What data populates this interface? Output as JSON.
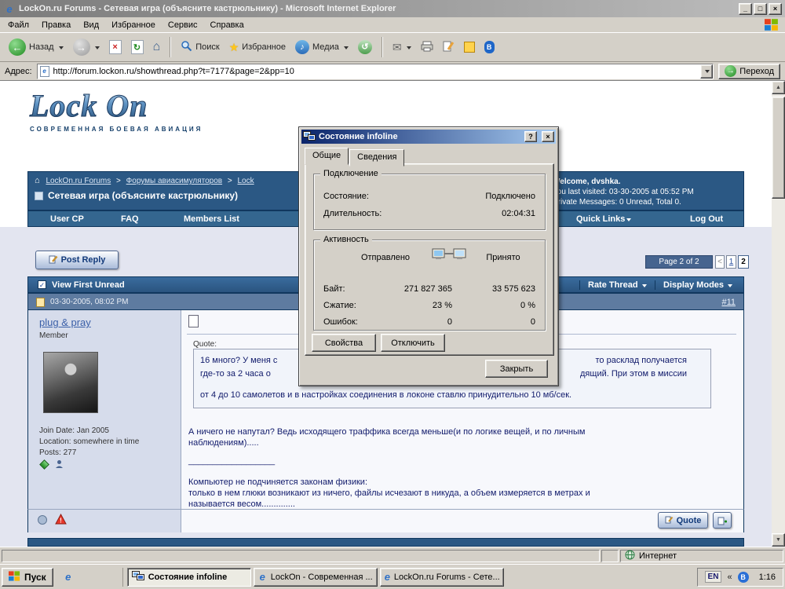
{
  "icons": {
    "minimize": "_",
    "maximize": "□",
    "close": "×",
    "help": "?",
    "back_arrow": "←",
    "forward_arrow": "→",
    "stop": "×",
    "refresh": "↻",
    "home": "⌂",
    "star": "★",
    "media_note": "♪",
    "history": "↺",
    "mail": "✉",
    "go_arrow": "→",
    "check": "✓",
    "scroll_up": "▲",
    "scroll_down": "▼",
    "chevron_left": "«",
    "bluetooth": "B",
    "ie": "e"
  },
  "browser": {
    "title": "LockOn.ru Forums - Сетевая игра (объясните кастрюльнику) - Microsoft Internet Explorer",
    "menu": [
      "Файл",
      "Правка",
      "Вид",
      "Избранное",
      "Сервис",
      "Справка"
    ],
    "toolbar": {
      "back": "Назад",
      "search": "Поиск",
      "favorites": "Избранное",
      "media": "Медиа"
    },
    "address": {
      "label": "Адрес:",
      "value": "http://forum.lockon.ru/showthread.php?t=7177&page=2&pp=10",
      "go": "Переход"
    }
  },
  "dialog": {
    "title": "Состояние infoline",
    "tabs": [
      "Общие",
      "Сведения"
    ],
    "connection": {
      "title": "Подключение",
      "rows": [
        {
          "label": "Состояние:",
          "value": "Подключено"
        },
        {
          "label": "Длительность:",
          "value": "02:04:31"
        }
      ]
    },
    "activity": {
      "title": "Активность",
      "sent": "Отправлено",
      "received": "Принято",
      "rows": [
        {
          "label": "Байт:",
          "sent": "271 827 365",
          "received": "33 575 623"
        },
        {
          "label": "Сжатие:",
          "sent": "23 %",
          "received": "0 %"
        },
        {
          "label": "Ошибок:",
          "sent": "0",
          "received": "0"
        }
      ]
    },
    "buttons": {
      "properties": "Свойства",
      "disconnect": "Отключить",
      "close": "Закрыть"
    }
  },
  "forum": {
    "logo": {
      "title": "Lock On",
      "subtitle": "СОВРЕМЕННАЯ БОЕВАЯ АВИАЦИЯ"
    },
    "breadcrumb": {
      "sep": ">",
      "items": [
        "LockOn.ru Forums",
        "Форумы авиасимуляторов",
        "Lock"
      ],
      "thread_title": "Сетевая игра (объясните кастрюльнику)"
    },
    "welcome": {
      "line1": "Welcome, dvshka.",
      "line2": "You last visited: 03-30-2005 at 05:52 PM",
      "line3": "Private Messages: 0 Unread, Total 0."
    },
    "navbar": [
      "User CP",
      "FAQ",
      "Members List",
      "Quick Links",
      "Log Out"
    ],
    "post_reply": "Post Reply",
    "pagination": {
      "badge": "Page 2 of 2",
      "prev": "<",
      "pages": [
        "1",
        "2"
      ]
    },
    "thread_bar": {
      "left": "View First Unread",
      "rate": "Rate Thread",
      "display": "Display Modes"
    },
    "post": {
      "date": "03-30-2005, 08:02 PM",
      "number": "#11",
      "user": {
        "name": "plug & pray",
        "title": "Member",
        "join": "Join Date: Jan 2005",
        "location": "Location: somewhere in time",
        "posts": "Posts: 277"
      },
      "quote_label": "Quote:",
      "quote_lines": [
        {
          "left": "16 много? У меня с",
          "right": "то расклад получается"
        },
        {
          "left": "где-то за 2 часа о",
          "right": "дящий. При этом в миссии"
        },
        {
          "full": "от 4 до 10 самолетов и в настройках соединения в локоне ставлю принудительно 10 мб/сек."
        }
      ],
      "body_line1": "А ничего не напутал? Ведь исходящего траффика всегда меньше(и по логике вещей, и по личным",
      "body_line2": "наблюдениям).....",
      "sig_sep": "__________________",
      "sig_line1": "Компьютер не подчиняется законам физики:",
      "sig_line2": "только в нем глюки возникают из ничего, файлы исчезают в никуда, а объем измеряется в метрах и",
      "sig_line3": "называется весом..............",
      "quote_button": "Quote"
    }
  },
  "statusbar": {
    "zone": "Интернет"
  },
  "taskbar": {
    "start": "Пуск",
    "tasks": [
      "Состояние infoline",
      "LockOn - Современная ...",
      "LockOn.ru Forums - Сете..."
    ],
    "tray": {
      "lang": "EN",
      "clock": "1:16"
    }
  }
}
